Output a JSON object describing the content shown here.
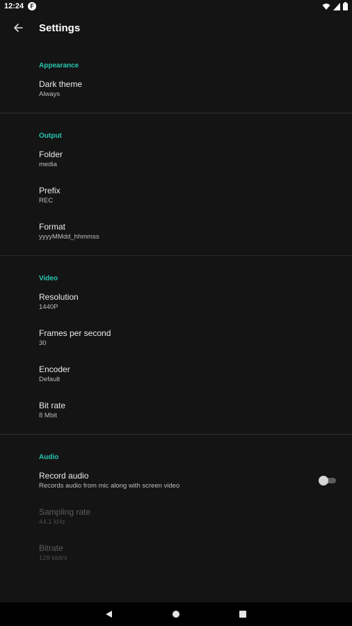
{
  "status_bar": {
    "time": "12:24",
    "app_badge": "F",
    "icons": [
      "wifi-icon",
      "cellular-icon",
      "battery-icon"
    ]
  },
  "toolbar": {
    "title": "Settings",
    "back_icon": "arrow-back-icon"
  },
  "colors": {
    "accent": "#26c6b0",
    "background": "#141414",
    "divider": "#2e2e2e"
  },
  "sections": {
    "appearance": {
      "header": "Appearance",
      "dark_theme": {
        "title": "Dark theme",
        "summary": "Always"
      }
    },
    "output": {
      "header": "Output",
      "folder": {
        "title": "Folder",
        "summary": "media"
      },
      "prefix": {
        "title": "Prefix",
        "summary": "REC"
      },
      "format": {
        "title": "Format",
        "summary": "yyyyMMdd_hhmmss"
      }
    },
    "video": {
      "header": "Video",
      "resolution": {
        "title": "Resolution",
        "summary": "1440P"
      },
      "fps": {
        "title": "Frames per second",
        "summary": "30"
      },
      "encoder": {
        "title": "Encoder",
        "summary": "Default"
      },
      "bitrate": {
        "title": "Bit rate",
        "summary": "8 Mbit"
      }
    },
    "audio": {
      "header": "Audio",
      "record_audio": {
        "title": "Record audio",
        "summary": "Records audio from mic along with screen video",
        "enabled": false
      },
      "sampling_rate": {
        "title": "Sampling rate",
        "summary": "44.1 kHz"
      },
      "bitrate": {
        "title": "Bitrate",
        "summary": "128 kbit/s"
      }
    }
  },
  "navbar": {
    "icons": [
      "back-triangle-icon",
      "home-circle-icon",
      "recents-square-icon"
    ]
  }
}
